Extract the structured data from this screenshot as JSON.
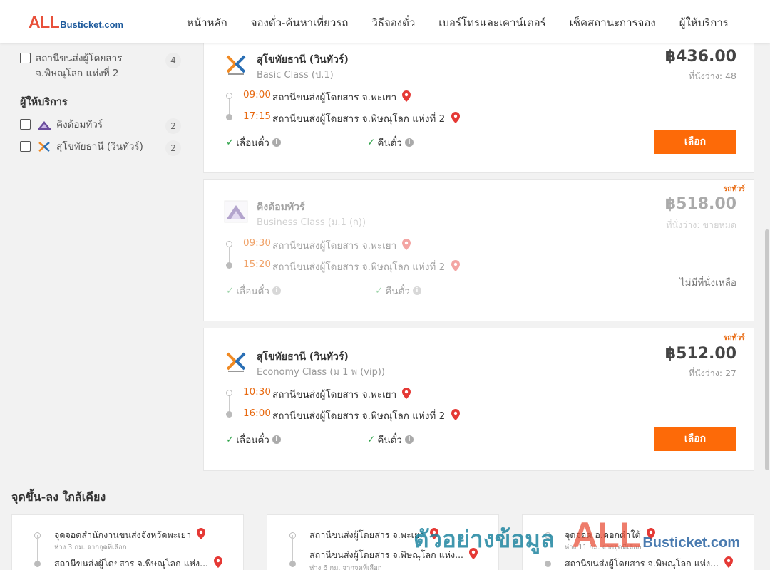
{
  "header": {
    "logo_all": "ALL",
    "logo_rest": "Busticket.com",
    "nav": [
      "หน้าหลัก",
      "จองตั๋ว-ค้นหาเที่ยวรถ",
      "วิธีจองตั๋ว",
      "เบอร์โทรและเคาน์เตอร์",
      "เช็คสถานะการจอง",
      "ผู้ให้บริการ"
    ]
  },
  "sidebar": {
    "station_filter": {
      "line1": "สถานีขนส่งผู้โดยสาร",
      "line2": "จ.พิษณุโลก แห่งที่ 2",
      "count": "4"
    },
    "operators_title": "ผู้ให้บริการ",
    "operators": [
      {
        "name": "คิงด้อมทัวร์",
        "count": "2",
        "logo": "kingdom-logo-icon"
      },
      {
        "name": "สุโขทัยธานี (วินทัวร์)",
        "count": "2",
        "logo": "sukhothai-logo-icon"
      }
    ]
  },
  "trips": [
    {
      "operator": "สุโขทัยธานี (วินทัวร์)",
      "class": "Basic Class (ป.1)",
      "price": "฿436.00",
      "seats": "ที่นั่งว่าง: 48",
      "depart_time": "09:00",
      "depart_stop": "สถานีขนส่งผู้โดยสาร จ.พะเยา",
      "arrive_time": "17:15",
      "arrive_stop": "สถานีขนส่งผู้โดยสาร จ.พิษณุโลก แห่งที่ 2",
      "feature1": "เลื่อนตั๋ว",
      "feature2": "คืนตั๋ว",
      "button": "เลือก",
      "tag": ""
    },
    {
      "operator": "คิงด้อมทัวร์",
      "class": "Business Class (ม.1 (ก))",
      "price": "฿518.00",
      "seats": "ที่นั่งว่าง: ขายหมด",
      "depart_time": "09:30",
      "depart_stop": "สถานีขนส่งผู้โดยสาร จ.พะเยา",
      "arrive_time": "15:20",
      "arrive_stop": "สถานีขนส่งผู้โดยสาร จ.พิษณุโลก แห่งที่ 2",
      "feature1": "เลื่อนตั๋ว",
      "feature2": "คืนตั๋ว",
      "status": "ไม่มีที่นั่งเหลือ",
      "tag": "รถทัวร์"
    },
    {
      "operator": "สุโขทัยธานี (วินทัวร์)",
      "class": "Economy Class (ม 1 พ (vip))",
      "price": "฿512.00",
      "seats": "ที่นั่งว่าง: 27",
      "depart_time": "10:30",
      "depart_stop": "สถานีขนส่งผู้โดยสาร จ.พะเยา",
      "arrive_time": "16:00",
      "arrive_stop": "สถานีขนส่งผู้โดยสาร จ.พิษณุโลก แห่งที่ 2",
      "feature1": "เลื่อนตั๋ว",
      "feature2": "คืนตั๋ว",
      "button": "เลือก",
      "tag": "รถทัวร์"
    }
  ],
  "nearby": {
    "title": "จุดขึ้น-ลง ใกล้เคียง",
    "cards": [
      {
        "from": "จุดจอดสำนักงานขนส่งจังหวัดพะเยา",
        "from_dist": "ห่าง 3 กม. จากจุดที่เลือก",
        "to": "สถานีขนส่งผู้โดยสาร จ.พิษณุโลก แห่ง...",
        "to_dist": ""
      },
      {
        "from": "สถานีขนส่งผู้โดยสาร จ.พะเยา",
        "from_dist": "",
        "to": "สถานีขนส่งผู้โดยสาร จ.พิษณุโลก แห่ง...",
        "to_dist": "ห่าง 6 กม. จากจุดที่เลือก"
      },
      {
        "from": "จุดจอด อ.ดอกคำใต้",
        "from_dist": "ห่าง 11 กม. จากจุดที่เลือก",
        "to": "สถานีขนส่งผู้โดยสาร จ.พิษณุโลก แห่ง...",
        "to_dist": ""
      }
    ]
  },
  "watermark": {
    "text": "ตัวอย่างข้อมูล",
    "all": "ALL",
    "rest": "Busticket.com"
  },
  "colors": {
    "accent": "#fd6a08",
    "time": "#e86a12",
    "check": "#2fa34a",
    "pin": "#e53935",
    "logo_red": "#e8503a",
    "logo_blue": "#1d5a9c"
  }
}
